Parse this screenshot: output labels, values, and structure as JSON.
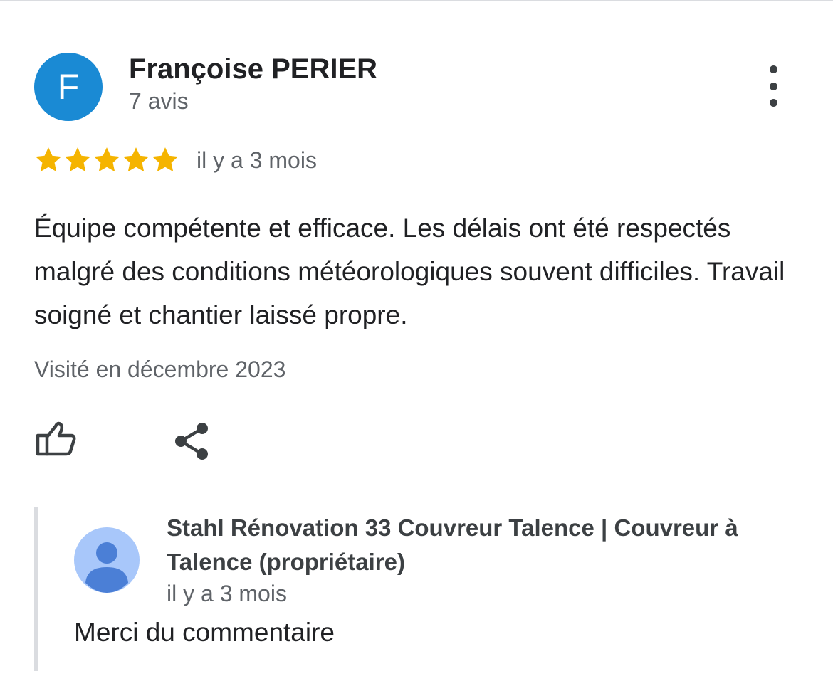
{
  "review": {
    "avatar_letter": "F",
    "author": "Françoise PERIER",
    "review_count": "7 avis",
    "rating": 5,
    "rating_max": 5,
    "time": "il y a 3 mois",
    "text": "Équipe compétente et efficace. Les délais ont été respectés malgré des conditions météorologiques souvent difficiles. Travail soigné et chantier laissé propre.",
    "visited": "Visité en décembre 2023"
  },
  "owner_reply": {
    "author": "Stahl Rénovation 33 Couvreur Talence | Couvreur à Talence (propriétaire)",
    "time": "il y a 3 mois",
    "text": "Merci du commentaire"
  },
  "colors": {
    "avatar": "#1a8ad4",
    "star": "#f5b400",
    "owner_avatar_bg": "#a8c7fa",
    "owner_avatar_fg": "#4b7fd6"
  },
  "icons": {
    "more": "more-vert-icon",
    "like": "thumb-up-icon",
    "share": "share-icon",
    "owner_avatar": "person-icon"
  }
}
